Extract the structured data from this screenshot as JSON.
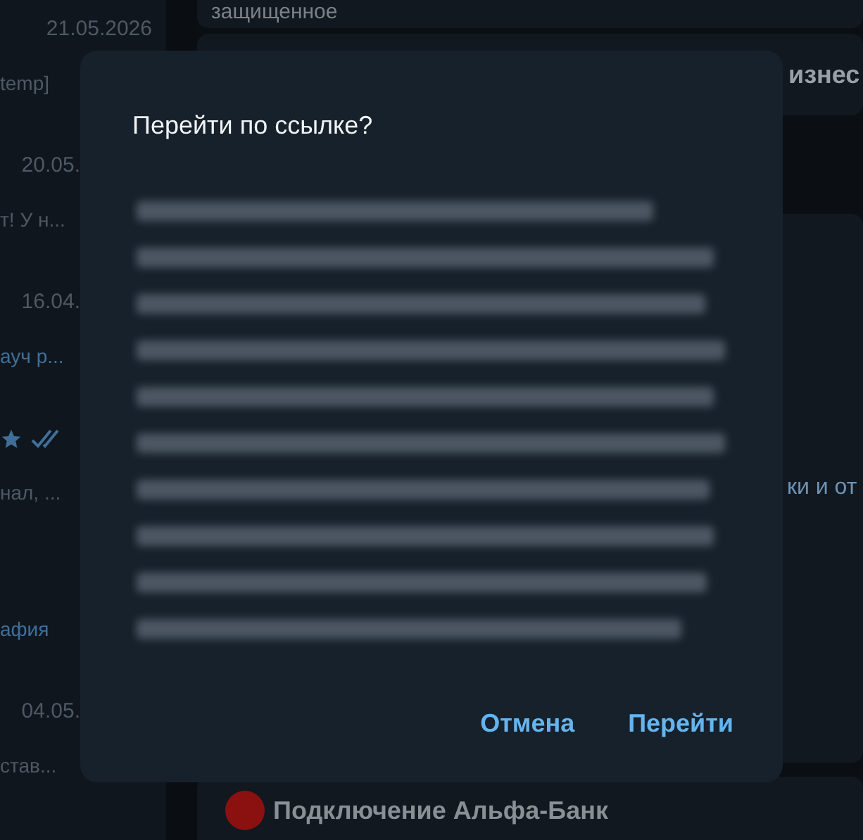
{
  "chat_list": [
    {
      "date": "21.05.2026",
      "preview": "temp]",
      "highlight": false,
      "status_icons": false
    },
    {
      "date": "20.05.",
      "preview": "т! У н...",
      "highlight": false,
      "status_icons": false
    },
    {
      "date": "16.04.",
      "preview": "ауч р...",
      "highlight": true,
      "status_icons": false
    },
    {
      "preview": "нал, ...",
      "highlight": false,
      "status_icons": true
    },
    {
      "preview": "афия",
      "highlight": true,
      "status_icons": false
    },
    {
      "date": "04.05.",
      "preview": "став...",
      "highlight": false,
      "status_icons": false
    }
  ],
  "messages": [
    {
      "kind": "plain",
      "text": "защищенное"
    },
    {
      "kind": "bold",
      "text": "изнес"
    },
    {
      "kind": "plain",
      "text": "ки и от"
    },
    {
      "kind": "dot",
      "text": "Подключение Альфа-Банк",
      "color": "#8b1111"
    }
  ],
  "dialog": {
    "title": "Перейти по ссылке?",
    "buttons": [
      "Отмена",
      "Перейти"
    ]
  }
}
